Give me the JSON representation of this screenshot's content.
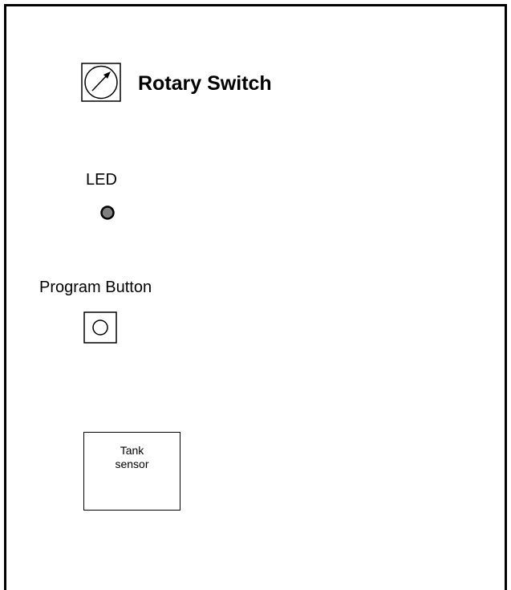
{
  "rotary_switch": {
    "label": "Rotary Switch",
    "icon": "rotary-dial-icon"
  },
  "led": {
    "label": "LED",
    "color": "#808080"
  },
  "program_button": {
    "label": "Program Button",
    "icon": "circle-button-icon"
  },
  "tank_sensor": {
    "line1": "Tank",
    "line2": "sensor"
  }
}
